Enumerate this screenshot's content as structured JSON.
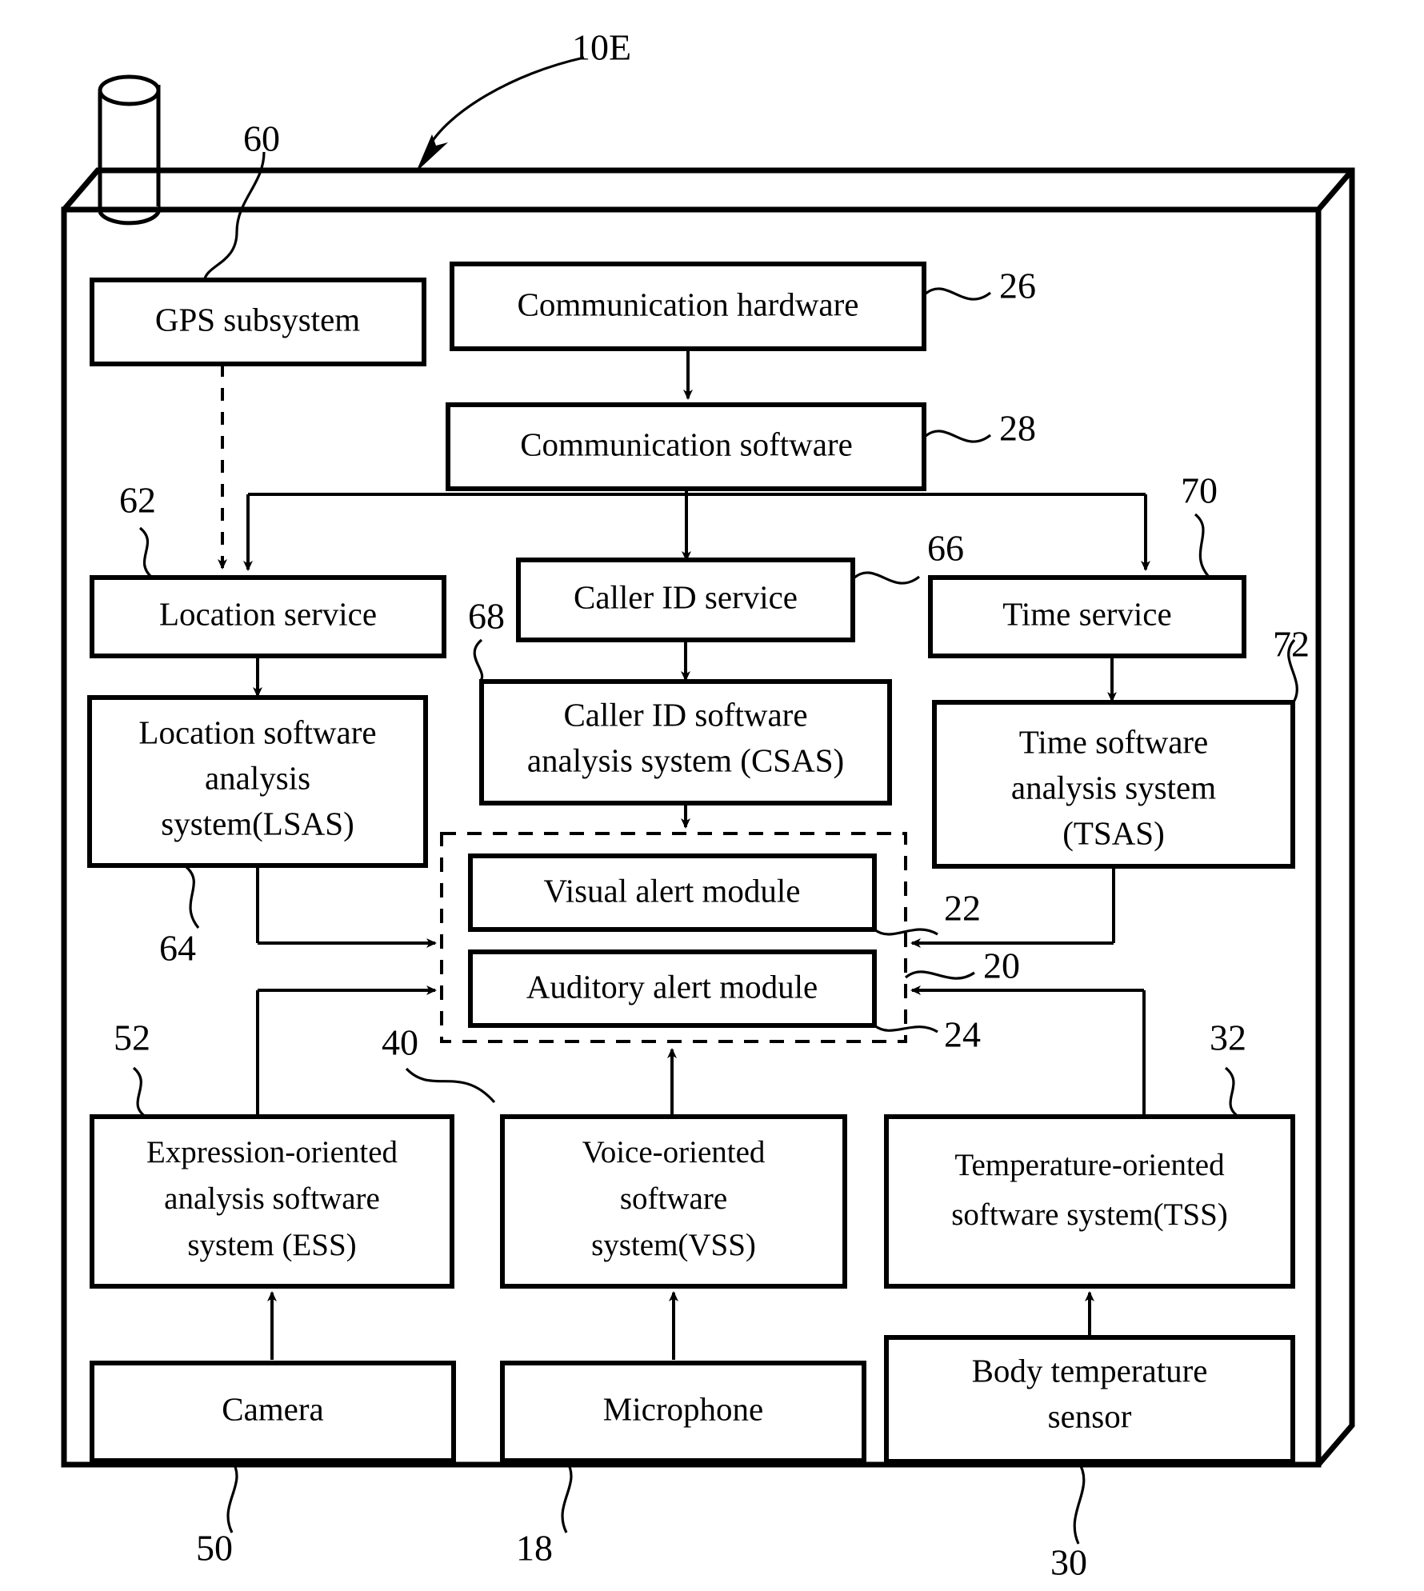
{
  "figure": {
    "label": "10E",
    "antenna": "antenna"
  },
  "boxes": {
    "gps": {
      "text": "GPS subsystem",
      "ref": "60"
    },
    "comm_hw": {
      "text": "Communication hardware",
      "ref": "26"
    },
    "comm_sw": {
      "text": "Communication software",
      "ref": "28"
    },
    "location_service": {
      "text": "Location service",
      "ref": "62"
    },
    "caller_id_service": {
      "text": "Caller ID service",
      "ref": "66"
    },
    "time_service": {
      "text": "Time service",
      "ref": "70"
    },
    "lsas": {
      "line1": "Location software",
      "line2": "analysis",
      "line3": "system(LSAS)",
      "ref": "64"
    },
    "csas": {
      "line1": "Caller ID software",
      "line2": "analysis system (CSAS)",
      "ref": "68"
    },
    "tsas": {
      "line1": "Time software",
      "line2": "analysis system",
      "line3": "(TSAS)",
      "ref": "72"
    },
    "visual_alert": {
      "text": "Visual alert module",
      "ref": "22"
    },
    "auditory_alert": {
      "text": "Auditory alert module",
      "ref": "24"
    },
    "alert_group": {
      "ref": "20"
    },
    "ess": {
      "line1": "Expression-oriented",
      "line2": "analysis software",
      "line3": "system (ESS)",
      "ref": "52"
    },
    "vss": {
      "line1": "Voice-oriented",
      "line2": "software",
      "line3": "system(VSS)",
      "ref": "40"
    },
    "tss": {
      "line1": "Temperature-oriented",
      "line2": "software system(TSS)",
      "ref": "32"
    },
    "camera": {
      "text": "Camera",
      "ref": "50"
    },
    "microphone": {
      "text": "Microphone",
      "ref": "18"
    },
    "body_temp": {
      "line1": "Body temperature",
      "line2": "sensor",
      "ref": "30"
    }
  }
}
